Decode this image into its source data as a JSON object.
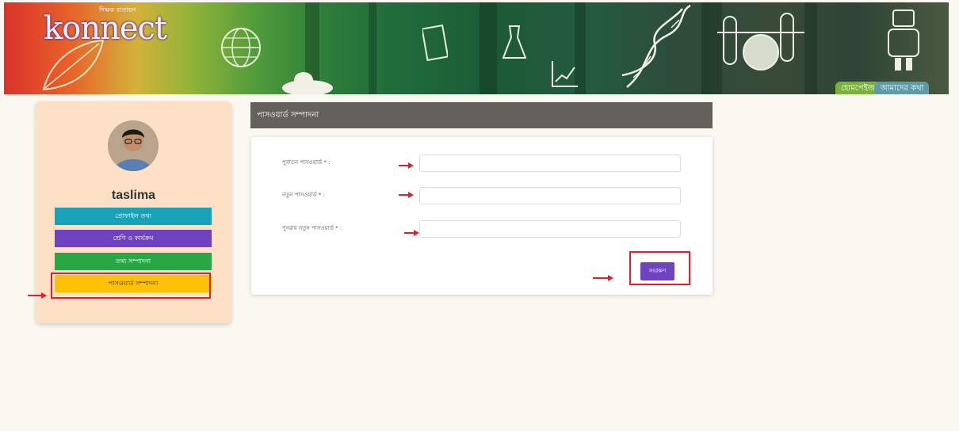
{
  "header": {
    "logo_text": "konnect",
    "logo_tagline": "শিক্ষক বাতায়ন",
    "nav": [
      {
        "label": "হোমপেইজ"
      },
      {
        "label": "আমাদের কথা"
      }
    ]
  },
  "sidebar": {
    "username": "taslima",
    "buttons": [
      {
        "label": "প্রোফাইল তথ্য",
        "color": "#17a2b8"
      },
      {
        "label": "শ্রেণি ও কার্যক্রম",
        "color": "#6f42c1"
      },
      {
        "label": "তথ্য সম্পাদনা",
        "color": "#28a745"
      },
      {
        "label": "পাসওয়ার্ড সম্পাদনা",
        "color": "#ffc107"
      }
    ]
  },
  "main": {
    "title": "পাসওয়ার্ড সম্পাদনা",
    "fields": [
      {
        "label": "পুরাতন পাসওয়ার্ড * :",
        "value": "",
        "placeholder": ""
      },
      {
        "label": "নতুন পাসওয়ার্ড * :",
        "value": "",
        "placeholder": ""
      },
      {
        "label": "পুনরায় নতুন পাসওয়ার্ড * :",
        "value": "",
        "placeholder": ""
      }
    ],
    "submit_label": "সংরক্ষণ"
  },
  "colors": {
    "annotation_red": "#e0202a",
    "panel_header": "#62615c",
    "sidebar_bg": "#fde0c6"
  }
}
